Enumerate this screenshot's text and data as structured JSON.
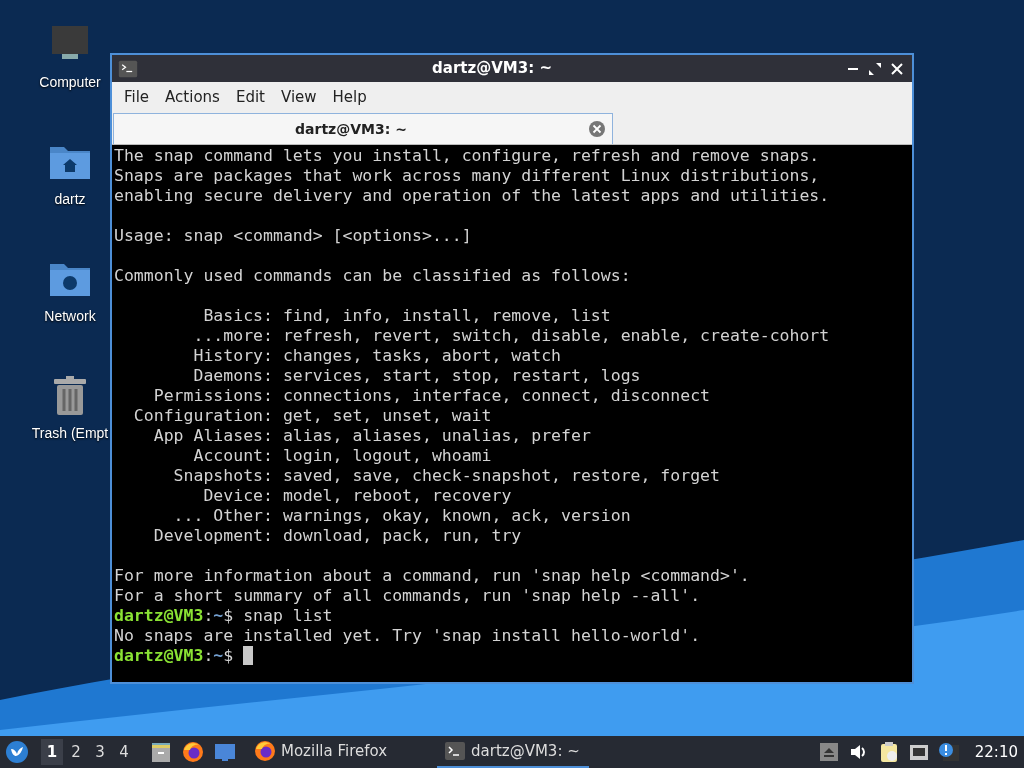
{
  "desktop_icons": [
    {
      "kind": "computer",
      "label": "Computer"
    },
    {
      "kind": "home",
      "label": "dartz"
    },
    {
      "kind": "network",
      "label": "Network"
    },
    {
      "kind": "trash",
      "label": "Trash (Empt"
    }
  ],
  "window": {
    "title": "dartz@VM3: ~",
    "menu": [
      "File",
      "Actions",
      "Edit",
      "View",
      "Help"
    ],
    "tabs": [
      {
        "label": "dartz@VM3: ~",
        "selected": true
      }
    ],
    "lines": [
      {
        "kind": "text",
        "text": "The snap command lets you install, configure, refresh and remove snaps."
      },
      {
        "kind": "text",
        "text": "Snaps are packages that work across many different Linux distributions,"
      },
      {
        "kind": "text",
        "text": "enabling secure delivery and operation of the latest apps and utilities."
      },
      {
        "kind": "blank"
      },
      {
        "kind": "text",
        "text": "Usage: snap <command> [<options>...]"
      },
      {
        "kind": "blank"
      },
      {
        "kind": "text",
        "text": "Commonly used commands can be classified as follows:"
      },
      {
        "kind": "blank"
      },
      {
        "kind": "text",
        "text": "         Basics: find, info, install, remove, list"
      },
      {
        "kind": "text",
        "text": "        ...more: refresh, revert, switch, disable, enable, create-cohort"
      },
      {
        "kind": "text",
        "text": "        History: changes, tasks, abort, watch"
      },
      {
        "kind": "text",
        "text": "        Daemons: services, start, stop, restart, logs"
      },
      {
        "kind": "text",
        "text": "    Permissions: connections, interface, connect, disconnect"
      },
      {
        "kind": "text",
        "text": "  Configuration: get, set, unset, wait"
      },
      {
        "kind": "text",
        "text": "    App Aliases: alias, aliases, unalias, prefer"
      },
      {
        "kind": "text",
        "text": "        Account: login, logout, whoami"
      },
      {
        "kind": "text",
        "text": "      Snapshots: saved, save, check-snapshot, restore, forget"
      },
      {
        "kind": "text",
        "text": "         Device: model, reboot, recovery"
      },
      {
        "kind": "text",
        "text": "      ... Other: warnings, okay, known, ack, version"
      },
      {
        "kind": "text",
        "text": "    Development: download, pack, run, try"
      },
      {
        "kind": "blank"
      },
      {
        "kind": "text",
        "text": "For more information about a command, run 'snap help <command>'."
      },
      {
        "kind": "text",
        "text": "For a short summary of all commands, run 'snap help --all'."
      },
      {
        "kind": "prompt",
        "user": "dartz@VM3",
        "sep": ":",
        "path": "~",
        "symbol": "$",
        "command": "snap list",
        "cursor": false
      },
      {
        "kind": "text",
        "text": "No snaps are installed yet. Try 'snap install hello-world'."
      },
      {
        "kind": "prompt",
        "user": "dartz@VM3",
        "sep": ":",
        "path": "~",
        "symbol": "$",
        "cursor": true
      }
    ]
  },
  "taskbar": {
    "workspaces": [
      {
        "label": "1",
        "selected": true
      },
      {
        "label": "2",
        "selected": false
      },
      {
        "label": "3",
        "selected": false
      },
      {
        "label": "4",
        "selected": false
      }
    ],
    "launchers": [
      {
        "kind": "files"
      },
      {
        "kind": "firefox"
      },
      {
        "kind": "desktop"
      }
    ],
    "tasks": [
      {
        "kind": "firefox",
        "label": "Mozilla Firefox",
        "selected": false
      },
      {
        "kind": "terminal",
        "label": "dartz@VM3: ~",
        "selected": true
      }
    ],
    "tray": [
      {
        "kind": "eject"
      },
      {
        "kind": "volume"
      },
      {
        "kind": "clipboard"
      },
      {
        "kind": "network"
      },
      {
        "kind": "notification"
      }
    ],
    "clock": "22:10"
  }
}
